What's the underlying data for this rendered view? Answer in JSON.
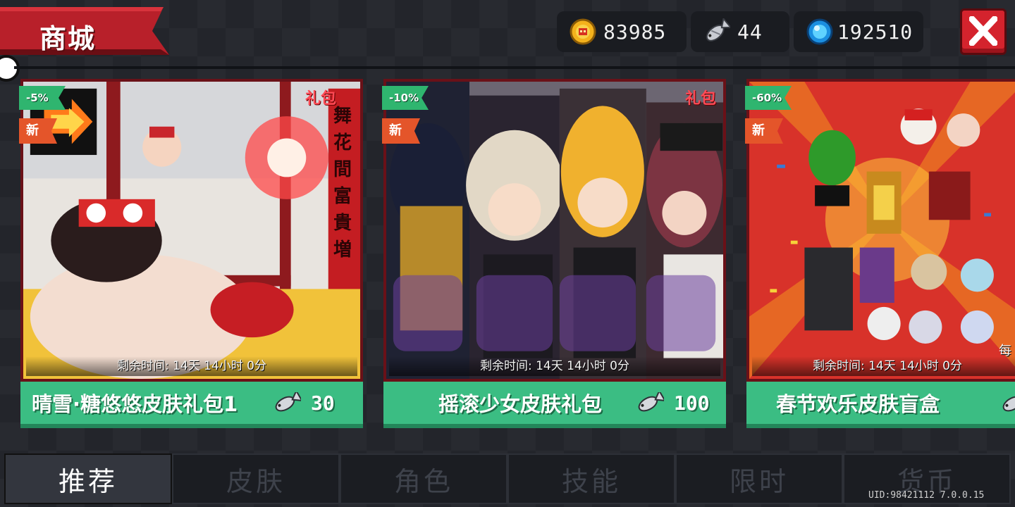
{
  "header": {
    "title": "商城"
  },
  "currencies": [
    {
      "icon": "gold-coin-icon",
      "value": "83985"
    },
    {
      "icon": "fish-icon",
      "value": "44"
    },
    {
      "icon": "blue-gem-icon",
      "value": "192510"
    }
  ],
  "packs": [
    {
      "discount": "-5%",
      "new_label": "新",
      "gift_tag": "礼包",
      "timer": "剩余时间: 14天 14小时 0分",
      "name": "晴雪·糖悠悠皮肤礼包1",
      "price": "30",
      "price_icon": "fish-icon",
      "banner_text": "舞花間富貴増"
    },
    {
      "discount": "-10%",
      "new_label": "新",
      "gift_tag": "礼包",
      "timer": "剩余时间: 14天 14小时 0分",
      "name": "摇滚少女皮肤礼包",
      "price": "100",
      "price_icon": "fish-icon"
    },
    {
      "discount": "-60%",
      "new_label": "新",
      "timer": "剩余时间: 14天 14小时 0分",
      "name": "春节欢乐皮肤盲盒",
      "price_icon": "fish-icon",
      "side_text": "每"
    }
  ],
  "tabs": [
    {
      "label": "推荐",
      "active": true
    },
    {
      "label": "皮肤"
    },
    {
      "label": "角色"
    },
    {
      "label": "技能"
    },
    {
      "label": "限时"
    },
    {
      "label": "货币"
    }
  ],
  "footer": {
    "uid": "UID:98421112 7.0.0.15"
  },
  "colors": {
    "accent_green": "#3bbd83",
    "close_red": "#d4232d",
    "banner_red": "#b8202a",
    "tab_active": "#33363e"
  }
}
